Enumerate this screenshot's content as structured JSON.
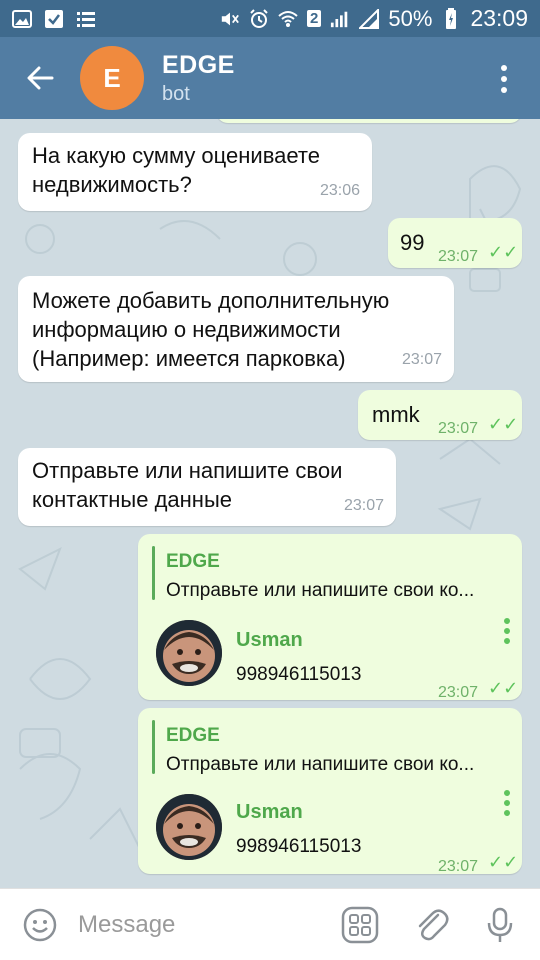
{
  "status_bar": {
    "battery": "50%",
    "time": "23:09",
    "sim": "2",
    "icons": [
      "image-icon",
      "checkbox-icon",
      "list-icon",
      "mute-icon",
      "alarm-icon",
      "wifi-icon",
      "signal-icon",
      "battery-icon"
    ]
  },
  "header": {
    "avatar_letter": "E",
    "title": "EDGE",
    "subtitle": "bot",
    "avatar_color": "#f08a3e",
    "bar_color": "#527da3"
  },
  "messages": [
    {
      "dir": "in",
      "text_lines": [
        "На какую сумму оцениваете",
        "недвижимость?"
      ],
      "time": "23:06"
    },
    {
      "dir": "out",
      "text_lines": [
        "99"
      ],
      "time": "23:07"
    },
    {
      "dir": "in",
      "text_lines": [
        "Можете добавить дополнительную",
        "информацию о недвижимости",
        "(Например: имеется парковка)"
      ],
      "time": "23:07"
    },
    {
      "dir": "out",
      "text_lines": [
        "mmk"
      ],
      "time": "23:07"
    },
    {
      "dir": "in",
      "text_lines": [
        "Отправьте или напишите свои",
        "контактные данные"
      ],
      "time": "23:07"
    },
    {
      "dir": "out",
      "reply_name": "EDGE",
      "reply_text": "Отправьте или напишите свои ко...",
      "contact_name": "Usman",
      "contact_phone": "998946115013",
      "time": "23:07"
    },
    {
      "dir": "out",
      "reply_name": "EDGE",
      "reply_text": "Отправьте или напишите свои ко...",
      "contact_name": "Usman",
      "contact_phone": "998946115013",
      "time": "23:07"
    }
  ],
  "input": {
    "placeholder": "Message"
  },
  "colors": {
    "incoming_bubble": "#ffffff",
    "outgoing_bubble": "#effdde",
    "accent_green": "#4fa84b"
  }
}
